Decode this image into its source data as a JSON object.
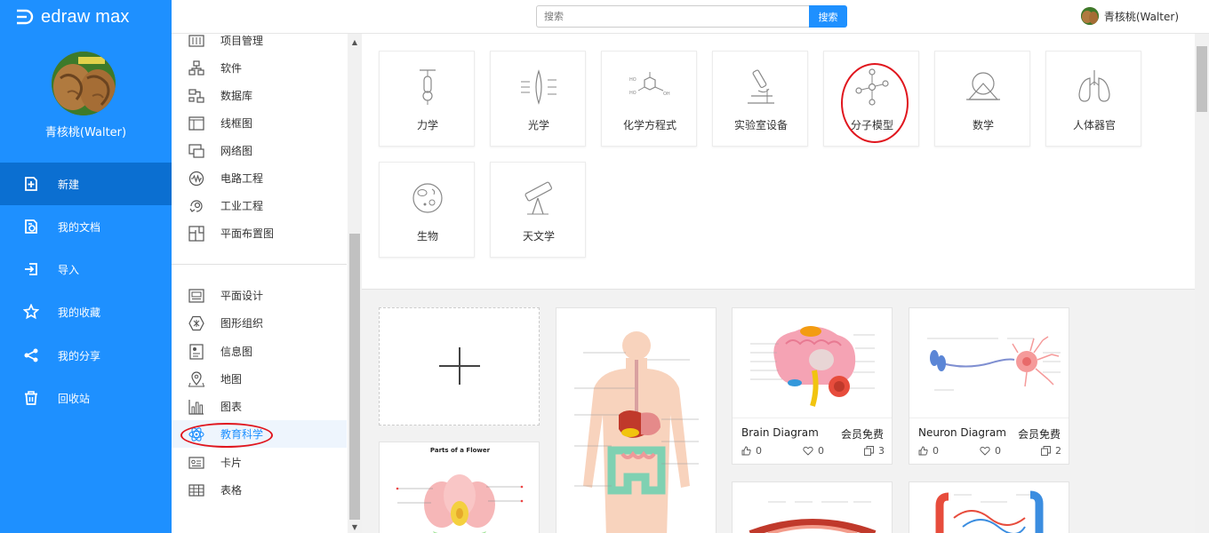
{
  "app": {
    "logo_text": "edraw max"
  },
  "sidebar": {
    "username": "青核桃(Walter)",
    "items": [
      {
        "label": "新建",
        "icon": "new-doc-icon",
        "active": true
      },
      {
        "label": "我的文档",
        "icon": "my-docs-icon"
      },
      {
        "label": "导入",
        "icon": "import-icon"
      },
      {
        "label": "我的收藏",
        "icon": "star-icon"
      },
      {
        "label": "我的分享",
        "icon": "share-icon"
      },
      {
        "label": "回收站",
        "icon": "trash-icon"
      }
    ]
  },
  "header": {
    "search_placeholder": "搜索",
    "search_button": "搜索",
    "username": "青核桃(Walter)"
  },
  "categories": {
    "group1": [
      {
        "label": "项目管理",
        "icon": "project-icon"
      },
      {
        "label": "软件",
        "icon": "software-icon"
      },
      {
        "label": "数据库",
        "icon": "database-icon"
      },
      {
        "label": "线框图",
        "icon": "wireframe-icon"
      },
      {
        "label": "网络图",
        "icon": "network-icon"
      },
      {
        "label": "电路工程",
        "icon": "circuit-icon"
      },
      {
        "label": "工业工程",
        "icon": "industrial-icon"
      },
      {
        "label": "平面布置图",
        "icon": "floorplan-icon"
      }
    ],
    "group2": [
      {
        "label": "平面设计",
        "icon": "graphic-design-icon"
      },
      {
        "label": "图形组织",
        "icon": "graphic-organizer-icon"
      },
      {
        "label": "信息图",
        "icon": "infographic-icon"
      },
      {
        "label": "地图",
        "icon": "map-icon"
      },
      {
        "label": "图表",
        "icon": "chart-icon"
      },
      {
        "label": "教育科学",
        "icon": "science-icon",
        "selected": true
      },
      {
        "label": "卡片",
        "icon": "card-icon"
      },
      {
        "label": "表格",
        "icon": "table-icon"
      }
    ]
  },
  "subcategories": [
    {
      "label": "力学",
      "icon": "mechanics-icon"
    },
    {
      "label": "光学",
      "icon": "optics-icon"
    },
    {
      "label": "化学方程式",
      "icon": "chemical-equation-icon"
    },
    {
      "label": "实验室设备",
      "icon": "microscope-icon"
    },
    {
      "label": "分子模型",
      "icon": "molecule-icon"
    },
    {
      "label": "数学",
      "icon": "math-icon"
    },
    {
      "label": "人体器官",
      "icon": "lungs-icon"
    },
    {
      "label": "生物",
      "icon": "cell-icon"
    },
    {
      "label": "天文学",
      "icon": "telescope-icon"
    }
  ],
  "templates": [
    {
      "title": "Parts of a Flower"
    },
    {
      "name": "Brain Diagram",
      "badge": "会员免费",
      "likes": "0",
      "favorites": "0",
      "copies": "3"
    },
    {
      "name": "Neuron Diagram",
      "badge": "会员免费",
      "likes": "0",
      "favorites": "0",
      "copies": "2"
    }
  ],
  "colors": {
    "accent": "#1e90ff",
    "sidebar_active": "#0b6fd1",
    "highlight": "#e0161e"
  }
}
